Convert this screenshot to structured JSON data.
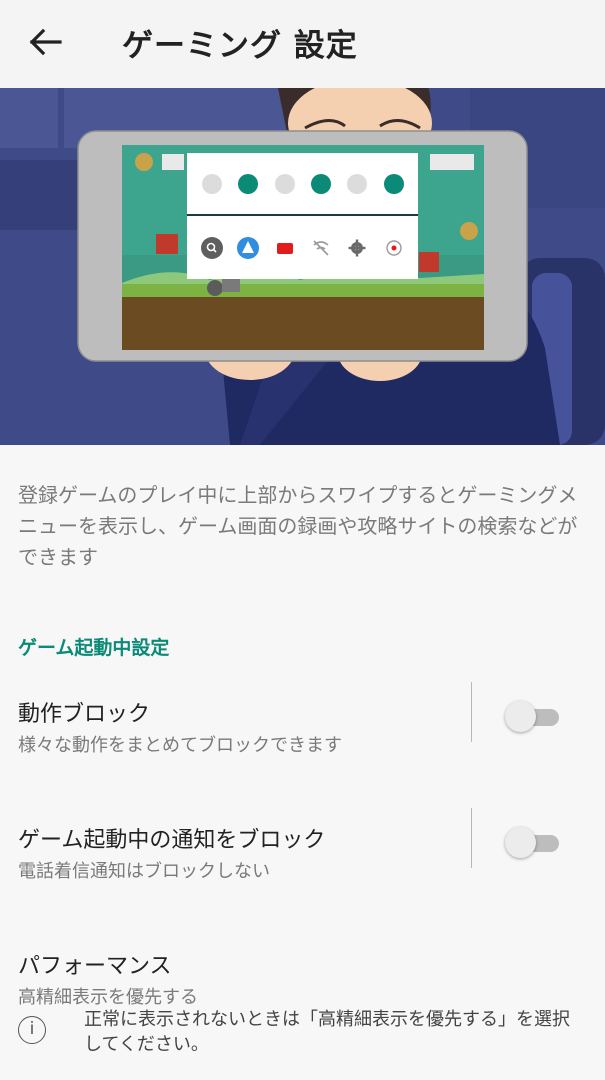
{
  "app_bar": {
    "back_icon": "arrow-left-icon",
    "title": "ゲーミング 設定"
  },
  "hero": {
    "menu_dots": [
      "off",
      "on",
      "off",
      "on",
      "off",
      "on"
    ],
    "accent_color": "#0b8a78",
    "menu_icons": [
      "search-icon",
      "assistant-icon",
      "video-icon",
      "wifi-off-icon",
      "gear-icon",
      "record-icon"
    ]
  },
  "description": "登録ゲームのプレイ中に上部からスワイプするとゲーミングメニューを表示し、ゲーム画面の録画や攻略サイトの検索などができます",
  "section": {
    "header": "ゲーム起動中設定"
  },
  "settings": [
    {
      "title": "動作ブロック",
      "subtitle": "様々な動作をまとめてブロックできます",
      "enabled": false
    },
    {
      "title": "ゲーム起動中の通知をブロック",
      "subtitle": "電話着信通知はブロックしない",
      "enabled": false
    },
    {
      "title": "パフォーマンス",
      "subtitle": "高精細表示を優先する"
    }
  ],
  "info": {
    "icon": "info-icon",
    "text": "正常に表示されないときは「高精細表示を優先する」を選択してください。"
  }
}
